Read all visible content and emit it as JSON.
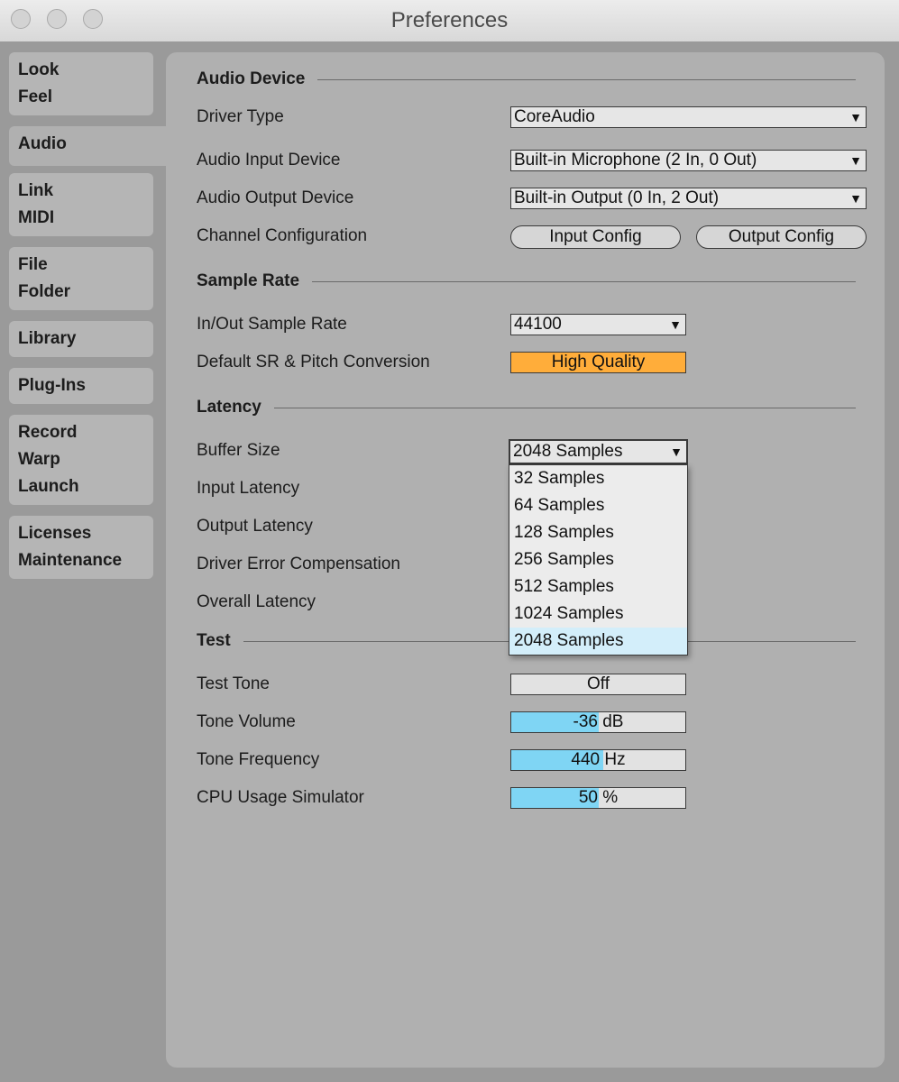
{
  "window": {
    "title": "Preferences"
  },
  "sidebar": {
    "tabs": [
      {
        "lines": [
          "Look",
          "Feel"
        ]
      },
      {
        "lines": [
          "Audio"
        ]
      },
      {
        "lines": [
          "Link",
          "MIDI"
        ]
      },
      {
        "lines": [
          "File",
          "Folder"
        ]
      },
      {
        "lines": [
          "Library"
        ]
      },
      {
        "lines": [
          "Plug-Ins"
        ]
      },
      {
        "lines": [
          "Record",
          "Warp",
          "Launch"
        ]
      },
      {
        "lines": [
          "Licenses",
          "Maintenance"
        ]
      }
    ],
    "active_tab": "Audio"
  },
  "audio_device": {
    "heading": "Audio Device",
    "driver_type_label": "Driver Type",
    "driver_type_value": "CoreAudio",
    "input_device_label": "Audio Input Device",
    "input_device_value": "Built-in Microphone (2 In, 0 Out)",
    "output_device_label": "Audio Output Device",
    "output_device_value": "Built-in Output (0 In, 2 Out)",
    "channel_config_label": "Channel Configuration",
    "input_config_button": "Input Config",
    "output_config_button": "Output Config"
  },
  "sample_rate": {
    "heading": "Sample Rate",
    "rate_label": "In/Out Sample Rate",
    "rate_value": "44100",
    "conversion_label": "Default SR & Pitch Conversion",
    "conversion_value": "High Quality"
  },
  "latency": {
    "heading": "Latency",
    "buffer_label": "Buffer Size",
    "buffer_value": "2048 Samples",
    "input_latency_label": "Input Latency",
    "output_latency_label": "Output Latency",
    "driver_comp_label": "Driver Error Compensation",
    "overall_latency_label": "Overall Latency",
    "buffer_options": [
      "32 Samples",
      "64 Samples",
      "128 Samples",
      "256 Samples",
      "512 Samples",
      "1024 Samples",
      "2048 Samples"
    ],
    "selected_option": "2048 Samples"
  },
  "test": {
    "heading": "Test",
    "tone_label": "Test Tone",
    "tone_value": "Off",
    "volume_label": "Tone Volume",
    "volume_value": "-36 dB",
    "volume_fill_fraction": 0.5,
    "frequency_label": "Tone Frequency",
    "frequency_value": "440 Hz",
    "frequency_fill_fraction": 0.53,
    "cpu_label": "CPU Usage Simulator",
    "cpu_value": "50 %",
    "cpu_fill_fraction": 0.5
  },
  "colors": {
    "accent_orange": "#ffad3a",
    "slider_fill": "#7fd5f4",
    "menu_selected": "#d3eefa"
  },
  "icons": [
    "close-button-icon",
    "minimize-button-icon",
    "zoom-button-icon",
    "dropdown-arrow-icon"
  ]
}
